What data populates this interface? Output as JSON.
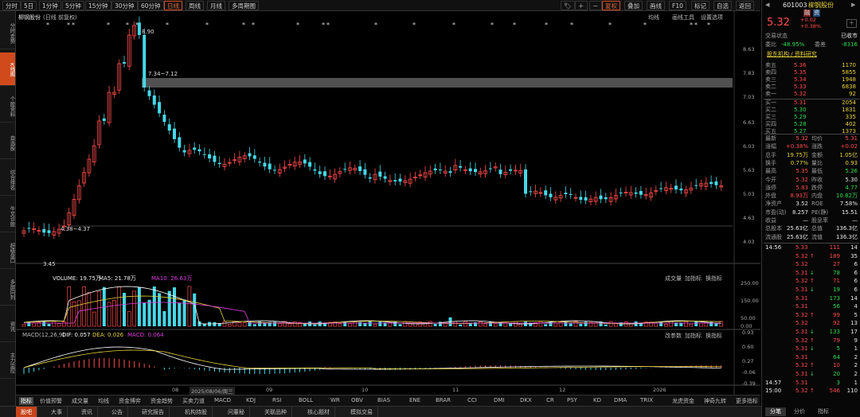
{
  "toolbar": {
    "items": [
      "分时",
      "5日",
      "1分钟",
      "5分钟",
      "15分钟",
      "30分钟",
      "60分钟",
      "日线",
      "周线",
      "月线",
      "多周期图"
    ],
    "active_index": 7,
    "right_items": [
      "复权",
      "叠加",
      "画线",
      "F10",
      "标记",
      "自选",
      "返回"
    ],
    "right_icons": [
      "tag-icon",
      "plus-icon",
      "minus-icon"
    ]
  },
  "leftbar": {
    "items": [
      "分时走势",
      "K线图",
      "个股资料",
      "自选股",
      "综合排名",
      "牛叉诊股",
      "超级盘口",
      "多屏同列",
      "资讯",
      "主力监控"
    ],
    "active_index": 1
  },
  "kline": {
    "title": "柳钢股份",
    "subtitle": "(日线 前复权)",
    "top_right_labels": [
      "均线",
      "画线工具",
      "设置选项"
    ],
    "price_ticks": [
      "8.63",
      "7.83",
      "7.03",
      "6.63",
      "6.03",
      "5.63",
      "5.03",
      "4.63",
      "4.03"
    ],
    "annotations": {
      "high": "8.90",
      "gap_label": "7.34~7.12",
      "low_label": "4.38~4.37",
      "bottom_label": "3.45"
    },
    "marks": [
      "*",
      "*",
      "*",
      "*",
      "*",
      "*",
      "*",
      "*",
      "*",
      "*",
      "*",
      "*",
      "*",
      "*",
      "*",
      "*",
      "*",
      "*",
      "*",
      "*",
      "*",
      "*",
      "*",
      "*",
      "*"
    ]
  },
  "volume": {
    "indicator_text": "VOLUME: 19.75万",
    "ma5_text": "MA5: 21.78万",
    "ma10_text": "MA10: 26.63万",
    "right_labels": [
      "成交量",
      "加指标",
      "换指标"
    ],
    "ticks": [
      "250.00",
      "150.00",
      "50.00",
      "0.00"
    ]
  },
  "macd": {
    "indicator_text": "MACD(12,26,9)",
    "dif_text": "DIF: 0.057",
    "dea_text": "DEA: 0.026",
    "macd_text": "MACD: 0.064",
    "right_labels": [
      "改参数",
      "加指标",
      "换指标"
    ],
    "ticks": [
      "0.93",
      "0.60",
      "0.27",
      "-0.06",
      "-0.39"
    ]
  },
  "xaxis": {
    "labels": [
      "08",
      "2025/08/06/周三",
      "09",
      "10",
      "11",
      "12",
      "2026"
    ]
  },
  "indicator_bar": {
    "items": [
      "指标",
      "价值预警",
      "成交量",
      "均线",
      "资金博弈",
      "资金趋势",
      "买卖力道",
      "MACD",
      "KDJ",
      "RSI",
      "BOLL",
      "WR",
      "OBV",
      "BIAS",
      "ENE",
      "BRAR",
      "CCI",
      "DMI",
      "DKX",
      "CR",
      "PSY",
      "KD",
      "DMA",
      "TRIX",
      "龙虎资金",
      "神奇九转",
      "更多指标",
      "模板"
    ]
  },
  "bottom_tabs": {
    "items": [
      "股吧",
      "大事",
      "资讯",
      "公告",
      "研究报告",
      "机构持股",
      "问董秘",
      "关联品种",
      "核心题材",
      "模拟交易"
    ],
    "active_index": 0
  },
  "quote": {
    "code": "601003",
    "name": "柳钢股份",
    "tags": [
      "融",
      "资"
    ],
    "price": "5.32",
    "change": "+0.02",
    "change_pct": "+0.38%",
    "status_label": "交易状态",
    "status_value": "已收市",
    "ratio_label": "委比",
    "ratio_value": "-48.95%",
    "diff_label": "委差",
    "diff_value": "-8316",
    "link_text": "股东机构 / 资料研究",
    "asks": [
      {
        "label": "卖五",
        "price": "5.36",
        "vol": "1170"
      },
      {
        "label": "卖四",
        "price": "5.35",
        "vol": "5855"
      },
      {
        "label": "卖三",
        "price": "5.34",
        "vol": "1948"
      },
      {
        "label": "卖二",
        "price": "5.33",
        "vol": "6838"
      },
      {
        "label": "卖一",
        "price": "5.32",
        "vol": "92"
      }
    ],
    "bids": [
      {
        "label": "买一",
        "price": "5.31",
        "vol": "2054"
      },
      {
        "label": "买二",
        "price": "5.30",
        "vol": "1831"
      },
      {
        "label": "买三",
        "price": "5.29",
        "vol": "335"
      },
      {
        "label": "买四",
        "price": "5.28",
        "vol": "402"
      },
      {
        "label": "买五",
        "price": "5.27",
        "vol": "1373"
      }
    ],
    "stats": [
      {
        "l1": "最新",
        "v1": "5.32",
        "l2": "均价",
        "v2": "5.31",
        "c1": "red",
        "c2": "red"
      },
      {
        "l1": "涨幅",
        "v1": "+0.38%",
        "l2": "涨跌",
        "v2": "+0.02",
        "c1": "red",
        "c2": "red"
      },
      {
        "l1": "总手",
        "v1": "19.75万",
        "l2": "金额",
        "v2": "1.05亿",
        "c1": "yellow",
        "c2": "yellow"
      },
      {
        "l1": "换手",
        "v1": "0.77%",
        "l2": "量比",
        "v2": "0.93",
        "c1": "yellow",
        "c2": "yellow"
      },
      {
        "l1": "最高",
        "v1": "5.35",
        "l2": "最低",
        "v2": "5.26",
        "c1": "red",
        "c2": "green"
      },
      {
        "l1": "今开",
        "v1": "5.32",
        "l2": "昨收",
        "v2": "5.30",
        "c1": "red",
        "c2": "white"
      },
      {
        "l1": "涨停",
        "v1": "5.83",
        "l2": "跌停",
        "v2": "4.77",
        "c1": "red",
        "c2": "green"
      },
      {
        "l1": "外盘",
        "v1": "8.93万",
        "l2": "内盘",
        "v2": "10.82万",
        "c1": "red",
        "c2": "green"
      },
      {
        "l1": "净资产",
        "v1": "3.52",
        "l2": "ROE",
        "v2": "7.58%",
        "c1": "white",
        "c2": "white"
      },
      {
        "l1": "市盈(动)",
        "v1": "8.257",
        "l2": "PE(静)",
        "v2": "15.51",
        "c1": "white",
        "c2": "white"
      },
      {
        "l1": "收益",
        "v1": "—",
        "l2": "股息率",
        "v2": "—",
        "c1": "white",
        "c2": "white"
      },
      {
        "l1": "总股本",
        "v1": "25.63亿",
        "l2": "总值",
        "v2": "136.3亿",
        "c1": "white",
        "c2": "white"
      },
      {
        "l1": "流通股",
        "v1": "25.63亿",
        "l2": "流值",
        "v2": "136.3亿",
        "c1": "white",
        "c2": "white"
      }
    ],
    "ticks": [
      {
        "t": "14:56",
        "p": "5.33",
        "d": "",
        "v": "111",
        "n": "14",
        "pc": "red",
        "vc": "red"
      },
      {
        "t": "",
        "p": "5.32",
        "d": "↑",
        "v": "189",
        "n": "35",
        "pc": "red",
        "vc": "red"
      },
      {
        "t": "",
        "p": "5.32",
        "d": "",
        "v": "27",
        "n": "6",
        "pc": "red",
        "vc": "red"
      },
      {
        "t": "",
        "p": "5.31",
        "d": "↓",
        "v": "78",
        "n": "6",
        "pc": "red",
        "vc": "green"
      },
      {
        "t": "",
        "p": "5.32",
        "d": "↑",
        "v": "71",
        "n": "6",
        "pc": "red",
        "vc": "red"
      },
      {
        "t": "",
        "p": "5.31",
        "d": "↓",
        "v": "19",
        "n": "6",
        "pc": "red",
        "vc": "green"
      },
      {
        "t": "",
        "p": "5.31",
        "d": "",
        "v": "173",
        "n": "14",
        "pc": "red",
        "vc": "green"
      },
      {
        "t": "",
        "p": "5.31",
        "d": "",
        "v": "56",
        "n": "4",
        "pc": "red",
        "vc": "green"
      },
      {
        "t": "",
        "p": "5.32",
        "d": "↑",
        "v": "99",
        "n": "5",
        "pc": "red",
        "vc": "red"
      },
      {
        "t": "",
        "p": "5.32",
        "d": "",
        "v": "92",
        "n": "13",
        "pc": "red",
        "vc": "red"
      },
      {
        "t": "",
        "p": "5.31",
        "d": "↓",
        "v": "133",
        "n": "17",
        "pc": "red",
        "vc": "green"
      },
      {
        "t": "",
        "p": "5.32",
        "d": "↑",
        "v": "79",
        "n": "9",
        "pc": "red",
        "vc": "red"
      },
      {
        "t": "",
        "p": "5.31",
        "d": "↓",
        "v": "5",
        "n": "1",
        "pc": "red",
        "vc": "green"
      },
      {
        "t": "",
        "p": "5.31",
        "d": "",
        "v": "64",
        "n": "2",
        "pc": "red",
        "vc": "green"
      },
      {
        "t": "",
        "p": "5.32",
        "d": "↑",
        "v": "10",
        "n": "2",
        "pc": "red",
        "vc": "red"
      },
      {
        "t": "",
        "p": "5.31",
        "d": "↓",
        "v": "20",
        "n": "2",
        "pc": "red",
        "vc": "green"
      },
      {
        "t": "14:57",
        "p": "5.31",
        "d": "",
        "v": "3",
        "n": "1",
        "pc": "red",
        "vc": "green"
      },
      {
        "t": "15:00",
        "p": "5.32",
        "d": "↑",
        "v": "546",
        "n": "110",
        "pc": "red",
        "vc": "red"
      }
    ],
    "bottom_tabs": [
      "分笔",
      "分价",
      "指标"
    ]
  },
  "colors": {
    "up": "#ff4b4b",
    "down": "#45d8e8",
    "accent": "#d14a1c",
    "ma5": "#ffffff",
    "ma10": "#e8d23a",
    "ma20": "#e040e0"
  }
}
